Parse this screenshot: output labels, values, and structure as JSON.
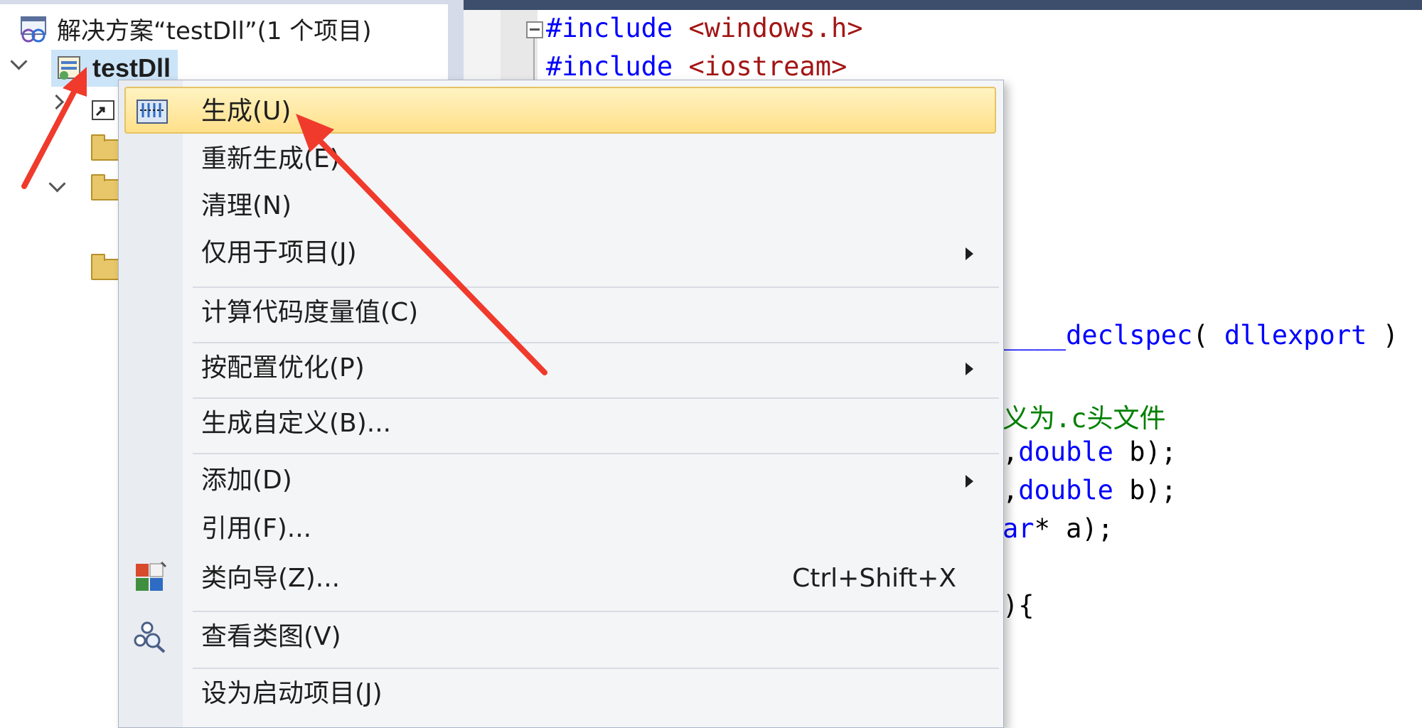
{
  "explorer": {
    "solution_label": "解决方案“testDll”(1 个项目)",
    "project_label": "testDll"
  },
  "editor": {
    "lines": {
      "l1_kw": "#include",
      "l1_str": " <windows.h>",
      "l2_kw": "#include",
      "l2_str": " <iostream>",
      "l3_kw": "__declspec",
      "l3_rest": "( ",
      "l3_kw2": "dllexport",
      "l3_end": " )",
      "l4_cm": "义为.c头文件",
      "l5_pre": ",",
      "l5_kw": "double",
      "l5_rest": " b);",
      "l6_pre": ",",
      "l6_kw": "double",
      "l6_rest": " b);",
      "l7_kw": "ar",
      "l7_rest": "* a);",
      "l8": "){"
    }
  },
  "context_menu": {
    "items": [
      {
        "label": "生成(U)"
      },
      {
        "label": "重新生成(E)"
      },
      {
        "label": "清理(N)"
      },
      {
        "label": "仅用于项目(J)"
      },
      {
        "label": "计算代码度量值(C)"
      },
      {
        "label": "按配置优化(P)"
      },
      {
        "label": "生成自定义(B)..."
      },
      {
        "label": "添加(D)"
      },
      {
        "label": "引用(F)..."
      },
      {
        "label": "类向导(Z)...",
        "shortcut": "Ctrl+Shift+X"
      },
      {
        "label": "查看类图(V)"
      },
      {
        "label": "设为启动项目(J)"
      }
    ]
  },
  "colors": {
    "highlight": "#ffe08a",
    "annotation_arrow": "#f03a2c",
    "keyword": "#0000ff",
    "string": "#a31515",
    "comment": "#008000"
  }
}
